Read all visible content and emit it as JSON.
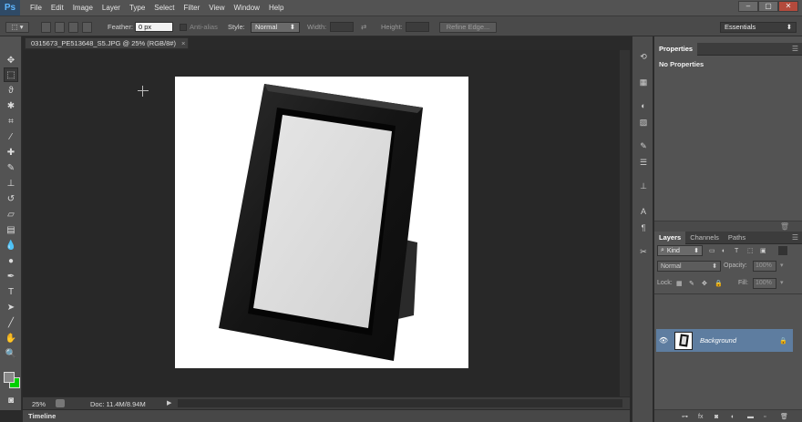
{
  "app": {
    "logo": "Ps"
  },
  "menu": [
    "File",
    "Edit",
    "Image",
    "Layer",
    "Type",
    "Select",
    "Filter",
    "View",
    "Window",
    "Help"
  ],
  "window_controls": [
    "–",
    "▢",
    "✕"
  ],
  "options": {
    "feather_label": "Feather:",
    "feather_value": "0 px",
    "antialias_label": "Anti-alias",
    "style_label": "Style:",
    "style_value": "Normal",
    "width_label": "Width:",
    "height_label": "Height:",
    "refine_button": "Refine Edge...",
    "workspace": "Essentials"
  },
  "document": {
    "tab_title": "0315673_PE513648_S5.JPG @ 25% (RGB/8#)",
    "close": "×",
    "zoom": "25%",
    "doc_info": "Doc: 11.4M/8.94M"
  },
  "timeline": {
    "label": "Timeline"
  },
  "properties": {
    "tab": "Properties",
    "status": "No Properties"
  },
  "layers_panel": {
    "tabs": [
      "Layers",
      "Channels",
      "Paths"
    ],
    "kind_label": "Kind",
    "blend_mode": "Normal",
    "opacity_label": "Opacity:",
    "opacity_value": "100%",
    "lock_label": "Lock:",
    "fill_label": "Fill:",
    "fill_value": "100%",
    "layers": [
      {
        "name": "Background"
      }
    ]
  },
  "colors": {
    "foreground": "#888888",
    "background": "#00d000",
    "selected_layer": "#5e7da0",
    "accent": "#5fb6ff"
  }
}
